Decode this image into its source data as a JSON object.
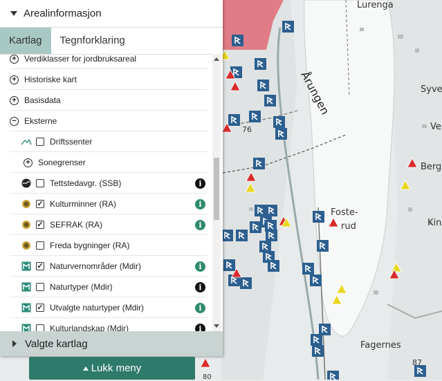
{
  "panel": {
    "title": "Arealinformasjon",
    "tabs": [
      {
        "label": "Kartlag",
        "active": true
      },
      {
        "label": "Tegnforklaring",
        "active": false
      }
    ]
  },
  "layers": [
    {
      "label": "Verdiklasser for jordbruksareal",
      "type": "group",
      "expanded": false
    },
    {
      "label": "Historiske kart",
      "type": "group",
      "expanded": false
    },
    {
      "label": "Basisdata",
      "type": "group",
      "expanded": false
    },
    {
      "label": "Eksterne",
      "type": "group",
      "expanded": true
    },
    {
      "label": "Driftssenter",
      "type": "layer",
      "icon": "mountain-icon",
      "checked": false,
      "info": null
    },
    {
      "label": "Sonegrenser",
      "type": "subgroup",
      "expanded": false
    },
    {
      "label": "Tettstedavgr. (SSB)",
      "type": "layer",
      "icon": "wave-icon",
      "checked": false,
      "info": "dark"
    },
    {
      "label": "Kulturminner (RA)",
      "type": "layer",
      "icon": "seal-icon",
      "checked": true,
      "info": "green"
    },
    {
      "label": "SEFRAK (RA)",
      "type": "layer",
      "icon": "seal-icon",
      "checked": true,
      "info": "green"
    },
    {
      "label": "Freda bygninger (RA)",
      "type": "layer",
      "icon": "seal-icon",
      "checked": false,
      "info": null
    },
    {
      "label": "Naturvernområder (Mdir)",
      "type": "layer",
      "icon": "nature-icon",
      "checked": true,
      "info": "green"
    },
    {
      "label": "Naturtyper (Mdir)",
      "type": "layer",
      "icon": "nature-icon",
      "checked": false,
      "info": "dark"
    },
    {
      "label": "Utvalgte naturtyper (Mdir)",
      "type": "layer",
      "icon": "nature-icon",
      "checked": true,
      "info": "green"
    },
    {
      "label": "Kulturlandskap (Mdir)",
      "type": "layer",
      "icon": "nature-icon",
      "checked": false,
      "info": "dark"
    }
  ],
  "selected_layers_label": "Valgte kartlag",
  "close_menu_label": "Lukk meny",
  "map": {
    "lake_label": "Årungen",
    "place_labels": [
      "Lurenga",
      "Syver",
      "Berg",
      "Kin",
      "Foste-",
      "rud",
      "Fagernes",
      "Ve"
    ],
    "road_numbers": [
      "76",
      "87",
      "80"
    ]
  },
  "colors": {
    "accent": "#2e7a6b",
    "tab_active": "#a8c8c3",
    "info_green": "#2e8a6c",
    "marker_blue": "#2d5f8f",
    "triangle_red": "#d92b2b",
    "triangle_yellow": "#e8d820"
  }
}
